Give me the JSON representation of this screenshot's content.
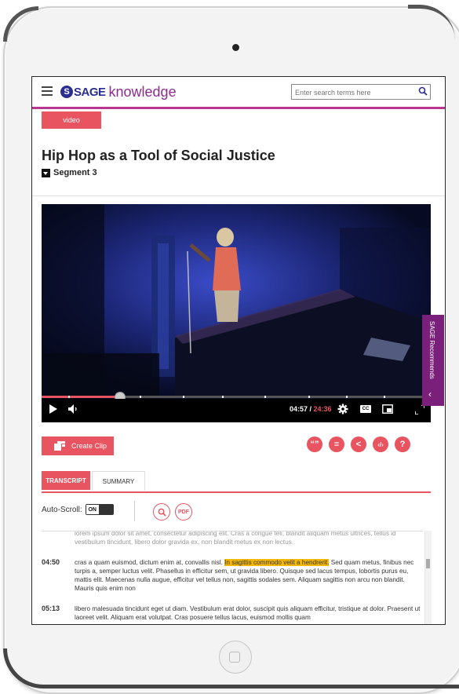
{
  "header": {
    "logo_symbol": "S",
    "logo_brand": "SAGE",
    "logo_product": "knowledge",
    "search_placeholder": "Enter search terms here"
  },
  "content_type": "video",
  "title": "Hip Hop as a Tool of Social Justice",
  "segment": "Segment 3",
  "player": {
    "current_time": "04:57",
    "separator": " / ",
    "duration": "24:36",
    "progress_fraction": 0.2,
    "cc_label": "CC"
  },
  "recommends_label": "SAGE Recommends",
  "actions": {
    "create_clip": "Create Clip",
    "cite_label": "“”",
    "playlist_label": "≡",
    "share_label": "<",
    "embed_label": "‹/›",
    "help_label": "?"
  },
  "tabs": [
    {
      "label": "TRANSCRIPT",
      "active": true
    },
    {
      "label": "SUMMARY",
      "active": false
    }
  ],
  "autoscroll": {
    "label": "Auto-Scroll:",
    "state": "ON"
  },
  "pdf_label": "PDF",
  "transcript": [
    {
      "time": "",
      "text": "lorem ipsum dolor sit amet, consectetur adipiscing elit. Cras a congue feli, blandit aliquam metus ultrices, tellus id vestibulum tincidunt, libero dolor gravida ex, non blandit metus ex non lectus."
    },
    {
      "time": "04:50",
      "text_before": "cras a quam euismod, dictum enim at, convallis nisl.",
      "highlight": "In sagittis commodo velit a hendrerit.",
      "text_after": "Sed quam metus, finibus nec turpis a, semper luctus velit. Phasellus in efficitur sem, ut gravida libero. Quisque sed lacus tempus, lobortis purus eu, mattis elit. Maecenas nulla augue, efficitur vel tellus non, sagittis sodales sem. Aliquam sagittis non arcu non blandit. Mauris quis enim non"
    },
    {
      "time": "05:13",
      "text": "libero malesuada tincidunt eget ut diam. Vestibulum erat dolor, suscipit quis aliquam efficitur, tristique at dolor. Praesent ut laoreet velit. Aliquam erat volutpat. Cras posuere tellus lacus, euismod mollis quam"
    }
  ],
  "colors": {
    "accent": "#e8545f",
    "brand": "#2b2e8f",
    "purple": "#7a1f7a",
    "highlight": "#f5b800"
  }
}
